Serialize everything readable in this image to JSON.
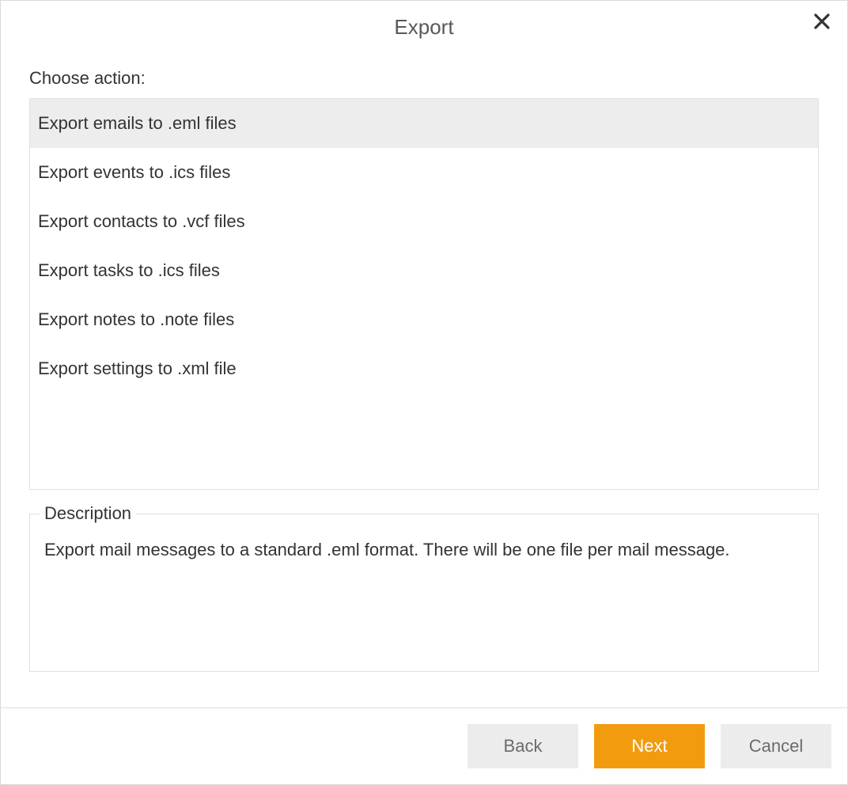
{
  "dialog": {
    "title": "Export",
    "choose_label": "Choose action:",
    "actions": [
      {
        "label": "Export emails to .eml files",
        "selected": true
      },
      {
        "label": "Export events to .ics files",
        "selected": false
      },
      {
        "label": "Export contacts to .vcf files",
        "selected": false
      },
      {
        "label": "Export tasks to .ics files",
        "selected": false
      },
      {
        "label": "Export notes to .note files",
        "selected": false
      },
      {
        "label": "Export settings to .xml file",
        "selected": false
      }
    ],
    "description": {
      "legend": "Description",
      "text": "Export mail messages to a standard .eml format. There will be one file per mail message."
    },
    "buttons": {
      "back": "Back",
      "next": "Next",
      "cancel": "Cancel"
    },
    "colors": {
      "primary": "#f39b0f",
      "secondary_bg": "#ececec",
      "border": "#e0e0e0",
      "selected_bg": "#ededed"
    }
  }
}
